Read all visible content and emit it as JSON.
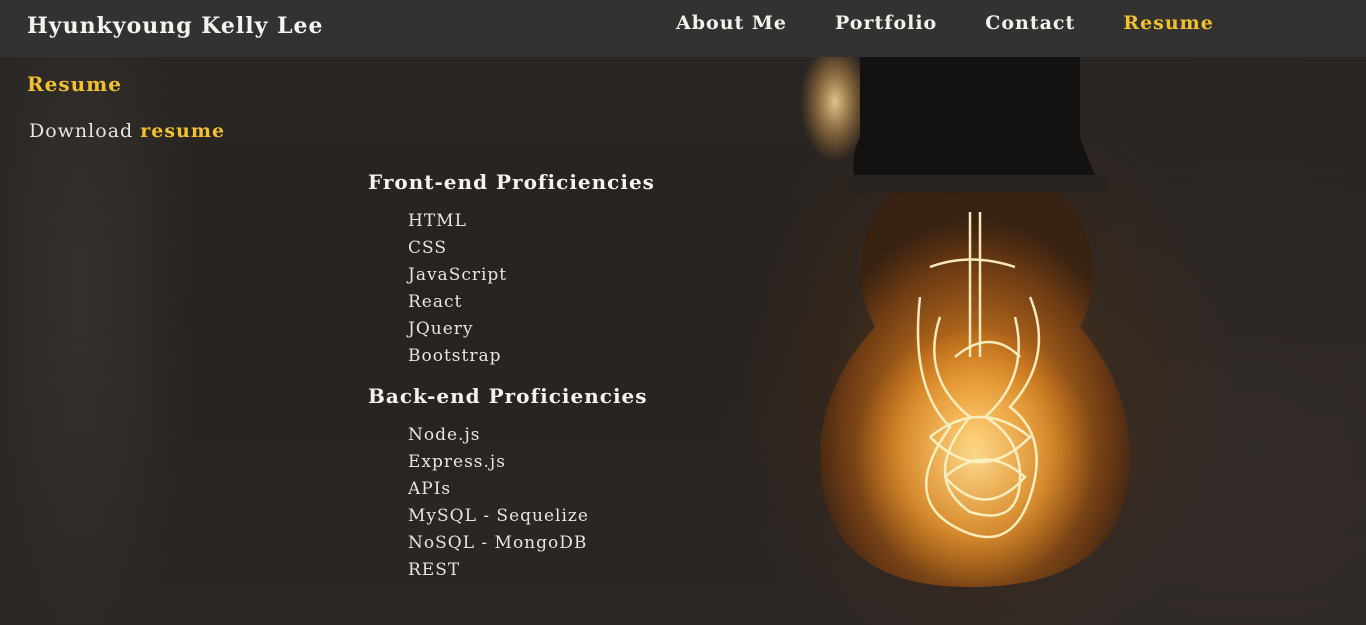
{
  "brand": "Hyunkyoung Kelly Lee",
  "nav": [
    {
      "label": "About Me",
      "active": false
    },
    {
      "label": "Portfolio",
      "active": false
    },
    {
      "label": "Contact",
      "active": false
    },
    {
      "label": "Resume",
      "active": true
    }
  ],
  "page_title": "Resume",
  "download": {
    "prefix": "Download",
    "link_label": "resume"
  },
  "frontend": {
    "heading": "Front-end Proficiencies",
    "items": [
      "HTML",
      "CSS",
      "JavaScript",
      "React",
      "JQuery",
      "Bootstrap"
    ]
  },
  "backend": {
    "heading": "Back-end Proficiencies",
    "items": [
      "Node.js",
      "Express.js",
      "APIs",
      "MySQL - Sequelize",
      "NoSQL - MongoDB",
      "REST"
    ]
  },
  "colors": {
    "accent": "#f2c12e",
    "navbar": "#333231",
    "text": "#e8e4df"
  },
  "background_image": "glowing-light-bulb"
}
